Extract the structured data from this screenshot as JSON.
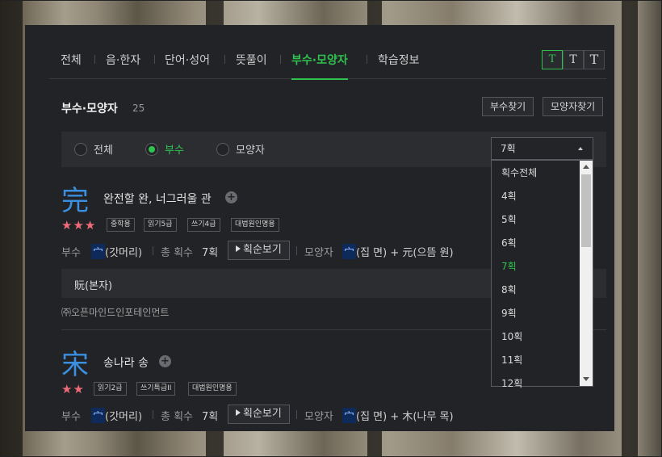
{
  "tabs": [
    {
      "label": "전체"
    },
    {
      "label": "음·한자"
    },
    {
      "label": "단어·성어"
    },
    {
      "label": "뜻풀이"
    },
    {
      "label": "부수·모양자"
    },
    {
      "label": "학습정보"
    }
  ],
  "font_size_buttons": [
    "T",
    "T",
    "T"
  ],
  "section": {
    "title": "부수·모양자",
    "count": "25"
  },
  "buttons": {
    "radical_search": "부수찾기",
    "shape_search": "모양자찾기"
  },
  "filter": {
    "options": [
      "전체",
      "부수",
      "모양자"
    ],
    "selected": "부수"
  },
  "stroke_select": {
    "value": "7획",
    "options": [
      "획수전체",
      "4획",
      "5획",
      "6획",
      "7획",
      "8획",
      "9획",
      "10획",
      "11획",
      "12획"
    ],
    "highlighted": "7획"
  },
  "entries": [
    {
      "hanja": "完",
      "meaning": "완전할 완, 너그러울 관",
      "stars": "★★★",
      "badges": [
        "중학용",
        "읽기5급",
        "쓰기4급",
        "대법원인명용"
      ],
      "radical_label": "부수",
      "radical_char": "宀",
      "radical_name": "(갓머리)",
      "stroke_label": "총 획수",
      "strokes": "7획",
      "stroke_order_btn": "획순보기",
      "shape_label": "모양자",
      "shape_char": "宀",
      "shape_part1": "(집 면)",
      "plus": "+",
      "shape_part2": "元(으뜸 원)",
      "bonja": "貦(본자)",
      "copyright": "㈜오픈마인드인포테인먼트"
    },
    {
      "hanja": "宋",
      "meaning": "송나라 송",
      "stars": "★★",
      "badges": [
        "읽기2급",
        "쓰기특급II",
        "대법원인명용"
      ],
      "radical_label": "부수",
      "radical_char": "宀",
      "radical_name": "(갓머리)",
      "stroke_label": "총 획수",
      "strokes": "7획",
      "stroke_order_btn": "획순보기",
      "shape_label": "모양자",
      "shape_char": "宀",
      "shape_part1": "(집 면)",
      "plus": "+",
      "shape_part2": "木(나무 목)"
    }
  ],
  "colors": {
    "accent": "#2fc24f",
    "hanja": "#3a8fe0",
    "star": "#ef6b7a",
    "panel": "#222326"
  }
}
